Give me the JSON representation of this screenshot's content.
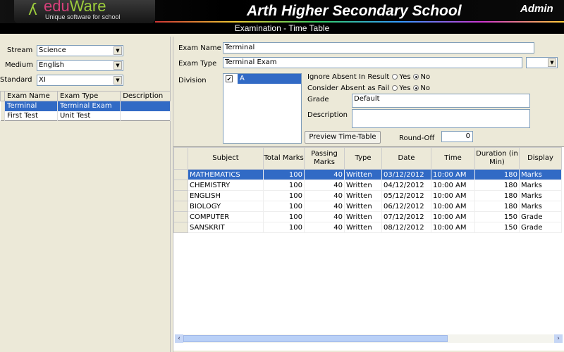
{
  "header": {
    "logo_brand_a": "edu",
    "logo_brand_b": "Ware",
    "logo_tagline": "Unique software for school",
    "school_name": "Arth Higher Secondary School",
    "user": "Admin",
    "screen_title": "Examination - Time Table"
  },
  "filters": {
    "stream_label": "Stream",
    "stream": "Science",
    "medium_label": "Medium",
    "medium": "English",
    "standard_label": "Standard",
    "standard": "XI"
  },
  "exam_list": {
    "columns": [
      "Exam Name",
      "Exam Type",
      "Description"
    ],
    "rows": [
      [
        "Terminal",
        "Terminal Exam",
        ""
      ],
      [
        "First Test",
        "Unit Test",
        ""
      ]
    ]
  },
  "form": {
    "exam_name_label": "Exam Name",
    "exam_name": "Terminal",
    "exam_type_label": "Exam Type",
    "exam_type": "Terminal Exam",
    "division_label": "Division",
    "division_item": "A",
    "ignore_absent_label": "Ignore Absent In Result",
    "consider_absent_label": "Consider Absent as Fail",
    "yes": "Yes",
    "no": "No",
    "grade_label": "Grade",
    "grade": "Default",
    "description_label": "Description",
    "description": "",
    "preview_button": "Preview Time-Table",
    "roundoff_label": "Round-Off",
    "roundoff": "0"
  },
  "timetable": {
    "columns": [
      "Subject",
      "Total Marks",
      "Passing Marks",
      "Type",
      "Date",
      "Time",
      "Duration (in Min)",
      "Display"
    ],
    "rows": [
      [
        "MATHEMATICS",
        "100",
        "40",
        "Written",
        "03/12/2012",
        "10:00 AM",
        "180",
        "Marks"
      ],
      [
        "CHEMISTRY",
        "100",
        "40",
        "Written",
        "04/12/2012",
        "10:00 AM",
        "180",
        "Marks"
      ],
      [
        "ENGLISH",
        "100",
        "40",
        "Written",
        "05/12/2012",
        "10:00 AM",
        "180",
        "Marks"
      ],
      [
        "BIOLOGY",
        "100",
        "40",
        "Written",
        "06/12/2012",
        "10:00 AM",
        "180",
        "Marks"
      ],
      [
        "COMPUTER",
        "100",
        "40",
        "Written",
        "07/12/2012",
        "10:00 AM",
        "150",
        "Grade"
      ],
      [
        "SANSKRIT",
        "100",
        "40",
        "Written",
        "08/12/2012",
        "10:00 AM",
        "150",
        "Grade"
      ]
    ]
  }
}
